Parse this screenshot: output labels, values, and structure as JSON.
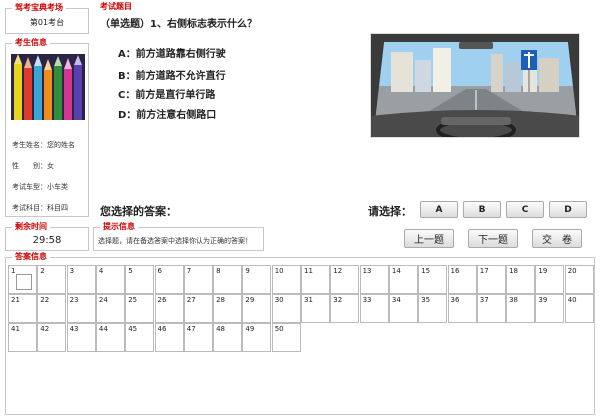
{
  "exam_site": {
    "title": "驾考宝典考场",
    "seat": "第01考台"
  },
  "candidate": {
    "title": "考生信息",
    "name_label": "考生姓名：",
    "name_value": "您的姓名",
    "gender_label": "性　　别：",
    "gender_value": "女",
    "car_label": "考试车型：",
    "car_value": "小车类",
    "subject_label": "考试科目：",
    "subject_value": "科目四"
  },
  "question": {
    "title": "考试题目",
    "text": "（单选题）1、右侧标志表示什么？",
    "options": [
      "A：前方道路靠右侧行驶",
      "B：前方道路不允许直行",
      "C：前方是直行单行路",
      "D：前方注意右侧路口"
    ],
    "your_answer_label": "您选择的答案：",
    "choose_label": "请选择：",
    "choice_buttons": [
      "A",
      "B",
      "C",
      "D"
    ]
  },
  "timer": {
    "title": "剩余时间",
    "value": "29:58"
  },
  "hint": {
    "title": "提示信息",
    "text": "选择题，请在备选答案中选择你认为正确的答案！"
  },
  "nav": {
    "prev": "上一题",
    "next": "下一题",
    "submit": "交　卷"
  },
  "answer_sheet": {
    "title": "答案信息"
  },
  "colors": {
    "accent": "#cc0000",
    "border": "#c8c8c8"
  }
}
